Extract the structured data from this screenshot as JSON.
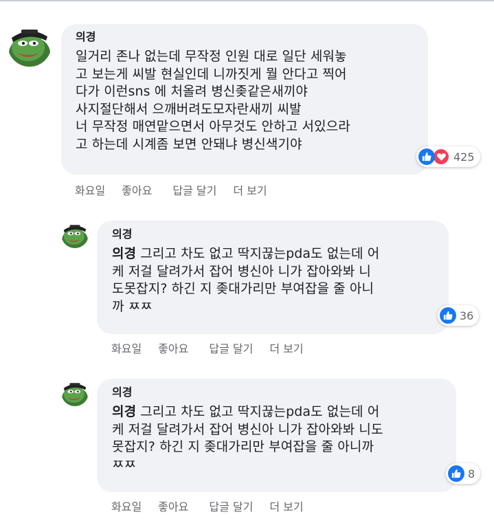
{
  "comments": [
    {
      "author": "의경",
      "lines": [
        "일거리 존나 없는데 무작정 인원 대로 일단 세워놓",
        "고 보는게 씨발 현실인데 니까짓게 뭘 안다고 찍어",
        "다가 이런sns 에 처올려 병신좆같은새끼야",
        "사지절단해서 으깨버려도모자란새끼 씨발",
        "너 무작정 매연맡으면서 아무것도 안하고 서있으라",
        "고 하는데 시계좀 보면 안돼냐 병신색기야"
      ],
      "reaction_icons": [
        "like-icon",
        "love-icon"
      ],
      "reaction_count": "425",
      "actions": {
        "time": "화요일",
        "like": "좋아요",
        "reply": "답글 달기",
        "more": "더 보기"
      }
    },
    {
      "author": "의경",
      "mention": "의경",
      "lines": [
        " 그리고 차도 없고 딱지끊는pda도 없는데 어",
        "케 저걸 달려가서 잡어 병신아 니가 잡아와봐 니",
        "도못잡지? 하긴 지 좆대가리만 부여잡을 줄 아니",
        "까 ㅉㅉ"
      ],
      "reaction_icons": [
        "like-icon"
      ],
      "reaction_count": "36",
      "actions": {
        "time": "화요일",
        "like": "좋아요",
        "reply": "답글 달기",
        "more": "더 보기"
      }
    },
    {
      "author": "의경",
      "mention": "의경",
      "lines": [
        " 그리고 차도 없고 딱지끊는pda도 없는데 어",
        "케 저걸 달려가서 잡어 병신아 니가 잡아와봐 니도",
        "못잡지? 하긴 지 좆대가리만 부여잡을 줄 아니까",
        "ㅉㅉ"
      ],
      "reaction_icons": [
        "like-icon"
      ],
      "reaction_count": "8",
      "actions": {
        "time": "화요일",
        "like": "좋아요",
        "reply": "답글 달기",
        "more": "더 보기"
      }
    }
  ],
  "colors": {
    "bubble": "#f0f2f5",
    "like_blue": "#1877f2",
    "love_red": "#f33e58",
    "secondary_text": "#65676b",
    "avatar_green": "#5aa34a"
  }
}
